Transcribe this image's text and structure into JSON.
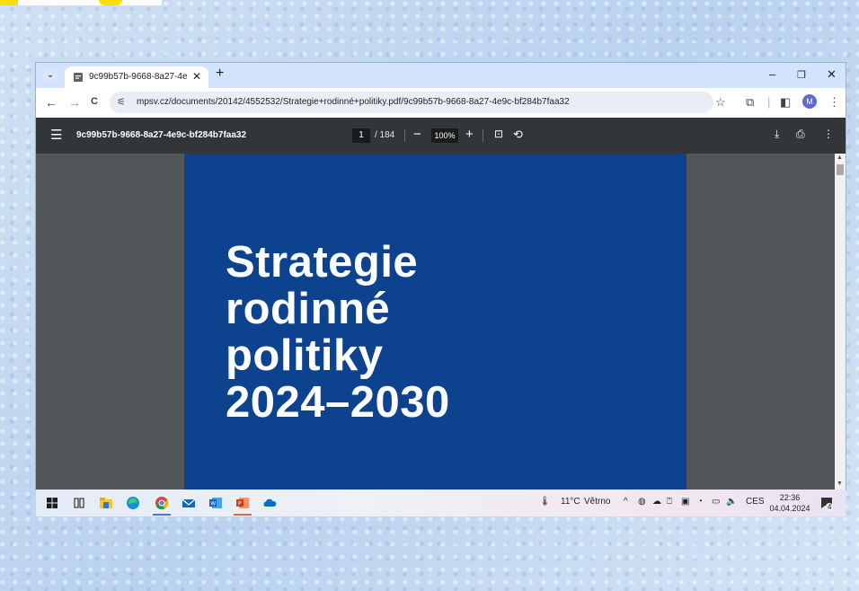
{
  "browser": {
    "tab_title": "9c99b57b-9668-8a27-4e9c-bf284b7faa32",
    "tab_close": "✕",
    "new_tab": "+",
    "tab_dropdown": "⌄",
    "window_controls": {
      "minimize": "–",
      "maximize": "❐",
      "close": "✕"
    },
    "url": "mpsv.cz/documents/20142/4552532/Strategie+rodinné+politiky.pdf/9c99b57b-9668-8a27-4e9c-bf284b7faa32",
    "nav": {
      "back": "←",
      "forward": "→",
      "reload": "C"
    },
    "avatar_letter": "M"
  },
  "pdf_viewer": {
    "file_name": "9c99b57b-9668-8a27-4e9c-bf284b7faa32",
    "current_page": "1",
    "page_total": "/ 184",
    "zoom": "100%",
    "zoom_out": "−",
    "zoom_in": "+",
    "page_title_lines": [
      "Strategie",
      "rodinné",
      "politiky",
      "2024–2030"
    ],
    "page_color": "#0d428f"
  },
  "taskbar": {
    "weather_temp": "11°C",
    "weather_text": "Větrno",
    "language": "CES",
    "time": "22:36",
    "date": "04.04.2024",
    "notification_count": "4"
  }
}
